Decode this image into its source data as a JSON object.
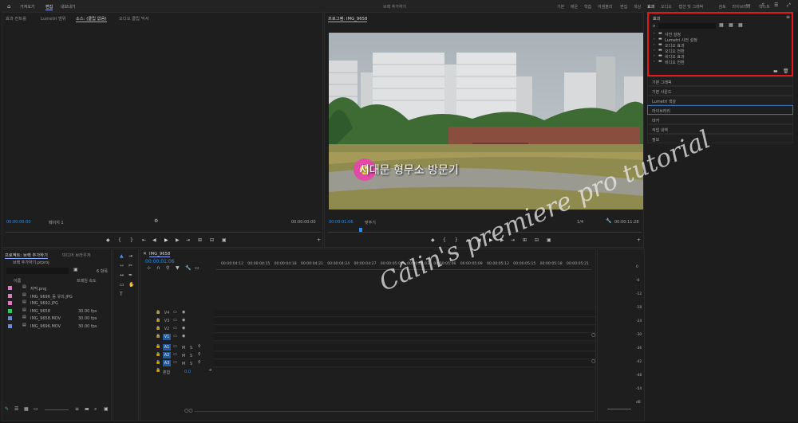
{
  "menubar": {
    "home_icon": "home-icon",
    "tabs": [
      "가져오기",
      "편집",
      "내보내기"
    ],
    "active_tab": "편집",
    "title": "브랙 추가하기",
    "workspaces": [
      "기본",
      "배운",
      "학습",
      "어셈블리",
      "편집",
      "색상",
      "효과",
      "오디오",
      "캡션 및 그래픽",
      "검토",
      "라이브러리",
      "학스트"
    ],
    "active_workspace": "효과"
  },
  "source_panel": {
    "tabs": [
      "효과 컨트롤",
      "Lumetri 범위",
      "소스: (클립 없음)",
      "오디오 클립 믹서"
    ],
    "active_tab": "소스: (클립 없음)",
    "timecode_left": "00:00:00:00",
    "page": "페이지 1",
    "timecode_right": "00:00:00:00"
  },
  "program_panel": {
    "tab": "프로그램: IMG_9658",
    "timecode_left": "00:00:01:06",
    "fit": "맞추기",
    "ratio": "1/4",
    "timecode_right": "00:00:11:28",
    "overlay_text": "서대문 형무소 방문기"
  },
  "effects_panel": {
    "title": "효과",
    "search_placeholder": "",
    "items": [
      "사전 설정",
      "Lumetri 사전 설정",
      "오디오 효과",
      "오디오 전환",
      "비디오 효과",
      "비디오 전환"
    ]
  },
  "right_panels": [
    "기본 그래픽",
    "기본 사운드",
    "Lumetri 색상",
    "라이브러리",
    "마커",
    "작업 내역",
    "정보"
  ],
  "right_active": "라이브러리",
  "project_panel": {
    "tabs": [
      "프로젝트: 브랙 추가하기",
      "미디어 브라우저"
    ],
    "project_file": "브랙 추가하기.prproj",
    "count": "6 항목",
    "columns": [
      "이름",
      "프레임 속도"
    ],
    "items": [
      {
        "name": "자막.png",
        "fps": "",
        "color": "#d77fbd"
      },
      {
        "name": "IMG_9696_동 유의.JPG",
        "fps": "",
        "color": "#d77fbd"
      },
      {
        "name": "IMG_9692.JPG",
        "fps": "",
        "color": "#d77fbd"
      },
      {
        "name": "IMG_9658",
        "fps": "30.00 fps",
        "color": "#35c06a"
      },
      {
        "name": "IMG_9658.MOV",
        "fps": "30.00 fps",
        "color": "#6b8bd8"
      },
      {
        "name": "IMG_9696.MOV",
        "fps": "30.00 fps",
        "color": "#6b8bd8"
      }
    ]
  },
  "timeline": {
    "tab": "IMG_9658",
    "timecode": "00:00:01:06",
    "ruler": [
      "00:00:04:12",
      "00:00:04:15",
      "00:00:04:18",
      "00:00:04:21",
      "00:00:04:24",
      "00:00:04:27",
      "00:00:05:00",
      "00:00:05:03",
      "00:00:05:06",
      "00:00:05:09",
      "00:00:05:12",
      "00:00:05:15",
      "00:00:05:18",
      "00:00:05:21"
    ],
    "video_tracks": [
      "V4",
      "V3",
      "V2",
      "V1"
    ],
    "audio_tracks": [
      "A1",
      "A2",
      "A3"
    ],
    "mix_label": "혼합",
    "mix_value": "0.0"
  },
  "meter_labels": [
    "0",
    "-6",
    "-12",
    "-18",
    "-24",
    "-30",
    "-36",
    "-42",
    "-48",
    "-54",
    "dB"
  ],
  "watermark": "Câlin's premiere pro tutorial"
}
